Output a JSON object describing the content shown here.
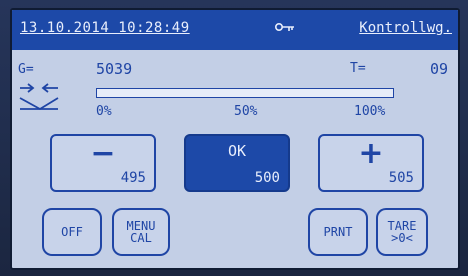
{
  "status": {
    "datetime": "13.10.2014 10:28:49",
    "mode_label": "Kontrollwg."
  },
  "readings": {
    "g_label": "G=",
    "g_value": "5039",
    "t_label": "T=",
    "t_value": "09"
  },
  "progress": {
    "fraction": 0,
    "labels": [
      "0%",
      "50%",
      "100%"
    ]
  },
  "buttons": {
    "minus": {
      "symbol": "−",
      "value": "495"
    },
    "ok": {
      "label": "OK",
      "value": "500"
    },
    "plus": {
      "symbol": "+",
      "value": "505"
    },
    "off": "OFF",
    "menu_line1": "MENU",
    "menu_line2": "CAL",
    "print": "PRNT",
    "tare_line1": "TARE",
    "tare_line2": ">0<"
  },
  "colors": {
    "accent": "#1d49a8",
    "text": "#1f45a5",
    "screen": "#c3cfe6"
  },
  "icons": [
    "key-icon",
    "direction-arrows-icon",
    "scale-pan-icon"
  ]
}
